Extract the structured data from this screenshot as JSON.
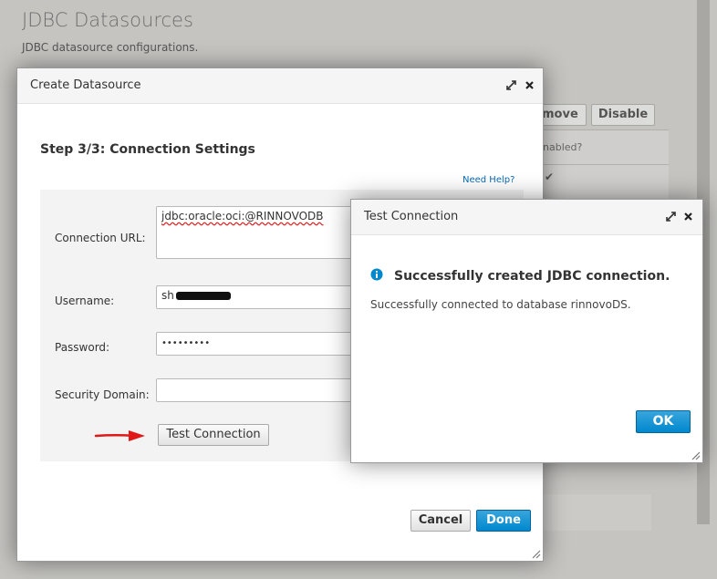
{
  "background_page": {
    "title": "JDBC Datasources",
    "subtitle": "JDBC datasource configurations.",
    "toolbar": {
      "remove_label": "move",
      "disable_label": "Disable"
    },
    "table": {
      "header_enabled": "nabled?",
      "row_check": "✔"
    }
  },
  "create_dialog": {
    "title": "Create Datasource",
    "step_title": "Step 3/3: Connection Settings",
    "help_link": "Need Help?",
    "fields": {
      "connection_url": {
        "label": "Connection URL:",
        "value": "jdbc:oracle:oci:@RINNOVODB"
      },
      "username": {
        "label": "Username:",
        "value": "sh"
      },
      "password": {
        "label": "Password:",
        "value": "•••••••••"
      },
      "security_domain": {
        "label": "Security Domain:",
        "value": ""
      }
    },
    "test_connection_label": "Test Connection",
    "cancel_label": "Cancel",
    "done_label": "Done"
  },
  "test_dialog": {
    "title": "Test Connection",
    "message_title": "Successfully created JDBC connection.",
    "message_body": "Successfully connected to database rinnovoDS.",
    "ok_label": "OK"
  },
  "colors": {
    "primary_button": "#0088ce",
    "link": "#0a6ab5",
    "info_icon": "#0088ce",
    "annotation_arrow": "#e01818"
  },
  "icons": [
    "maximize-icon",
    "close-icon",
    "info-icon",
    "resize-grip-icon",
    "red-arrow-annotation"
  ]
}
